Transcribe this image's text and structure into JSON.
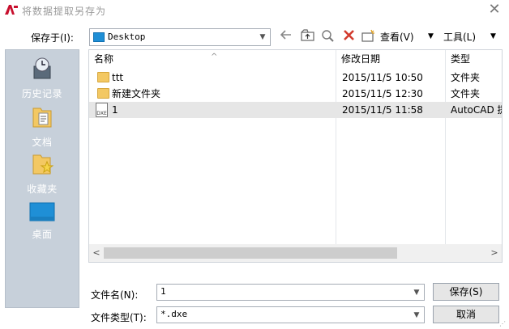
{
  "window": {
    "title": "将数据提取另存为",
    "close_glyph": "✕"
  },
  "toolbar": {
    "save_in_label": "保存于(I):",
    "location_value": "Desktop",
    "view_label": "查看(V)",
    "tools_label": "工具(L)"
  },
  "places": [
    {
      "label": "历史记录",
      "icon": "history-icon"
    },
    {
      "label": "文档",
      "icon": "documents-icon"
    },
    {
      "label": "收藏夹",
      "icon": "favorites-icon"
    },
    {
      "label": "桌面",
      "icon": "desktop-icon"
    }
  ],
  "file_list": {
    "columns": [
      "名称",
      "修改日期",
      "类型"
    ],
    "rows": [
      {
        "name": "ttt",
        "date": "2015/11/5 10:50",
        "type": "文件夹",
        "kind": "folder"
      },
      {
        "name": "新建文件夹",
        "date": "2015/11/5 12:30",
        "type": "文件夹",
        "kind": "folder"
      },
      {
        "name": "1",
        "date": "2015/11/5 11:58",
        "type": "AutoCAD 提",
        "kind": "dxe"
      }
    ],
    "selected_row": 2,
    "dxe_icon_text": "DXE"
  },
  "filename": {
    "label": "文件名(N):",
    "value": "1"
  },
  "filetype": {
    "label": "文件类型(T):",
    "value": "*.dxe"
  },
  "buttons": {
    "save": "保存(S)",
    "cancel": "取消"
  },
  "colors": {
    "places_bg": "#c7d0da",
    "selected_row": "#e6e6e6",
    "folder_yellow": "#f3c863",
    "desktop_blue": "#1f8fd6"
  }
}
